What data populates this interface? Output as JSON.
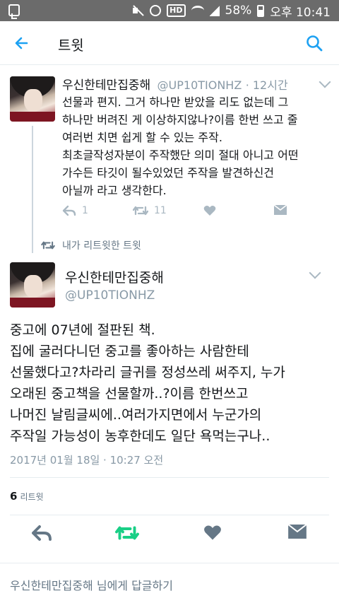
{
  "status_bar": {
    "battery": "58%",
    "time": "오후 10:41",
    "hd": "HD"
  },
  "app_bar": {
    "title": "트윗"
  },
  "parent_tweet": {
    "author_name": "우신한테만집중해",
    "handle": "@UP10TIONHZ",
    "time": "· 12시간",
    "body_lines": [
      "선물과 편지. 그거 하나만 받았을 리도 없는데 그",
      "하나만 버려진 게 이상하지않나?이름 한번 쓰고 줄",
      "여러번 치면 쉽게 할 수 있는 주작.",
      "최초글작성자분이 주작했단 의미 절대 아니고 어떤",
      "가수든 타깃이 될수있었던 주작을 발견하신건",
      "아닐까 라고 생각한다."
    ],
    "reply_count": "1",
    "retweet_count": "11"
  },
  "retweet_note": "내가 리트윗한 트윗",
  "main_tweet": {
    "author_name": "우신한테만집중해",
    "handle": "@UP10TIONHZ",
    "body_lines": [
      "중고에 07년에 절판된 책.",
      "집에 굴러다니던 중고를 좋아하는 사람한테",
      "선물했다고?차라리 글귀를 정성쓰레 써주지, 누가",
      "오래된 중고책을 선물할까..?이름 한번쓰고",
      "나머진 날림글씨에..여러가지면에서 누군가의",
      "주작일 가능성이 농후한데도 일단 욕먹는구나.."
    ],
    "date": "2017년 01월 18일 · 10:27 오전",
    "retweets": "6",
    "retweets_label": "리트윗"
  },
  "reply_prompt": "우신한테만집중해 님에게 답글하기",
  "colors": {
    "accent": "#1da1f2",
    "retweet_green": "#19cf86",
    "icon_gray": "#aab8c2",
    "icon_dark": "#657786",
    "status_bar": "#6b6b6b"
  }
}
